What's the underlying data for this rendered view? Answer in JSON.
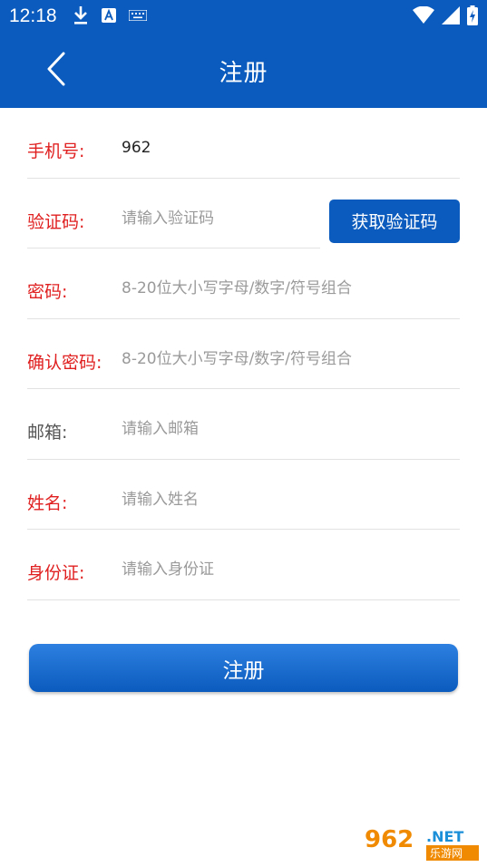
{
  "status_bar": {
    "time": "12:18",
    "icons_left": [
      "download-icon",
      "text-a-icon",
      "keyboard-icon"
    ],
    "icons_right": [
      "wifi-icon",
      "signal-icon",
      "battery-charging-icon"
    ]
  },
  "app_bar": {
    "title": "注册",
    "back_icon": "chevron-left-icon"
  },
  "form": {
    "phone": {
      "label": "手机号:",
      "value": "962",
      "placeholder": ""
    },
    "code": {
      "label": "验证码:",
      "placeholder": "请输入验证码",
      "button_label": "获取验证码"
    },
    "password": {
      "label": "密码:",
      "placeholder": "8-20位大小写字母/数字/符号组合"
    },
    "confirm_password": {
      "label": "确认密码:",
      "placeholder": "8-20位大小写字母/数字/符号组合"
    },
    "email": {
      "label": "邮箱:",
      "placeholder": "请输入邮箱"
    },
    "name": {
      "label": "姓名:",
      "placeholder": "请输入姓名"
    },
    "id_card": {
      "label": "身份证:",
      "placeholder": "请输入身份证"
    }
  },
  "submit_label": "注册",
  "watermark": {
    "brand": "962.NET",
    "subtitle": "乐游网"
  },
  "colors": {
    "primary": "#0a5bbd",
    "required_label": "#e02020",
    "optional_label": "#555555",
    "placeholder": "#9a9a9a"
  }
}
